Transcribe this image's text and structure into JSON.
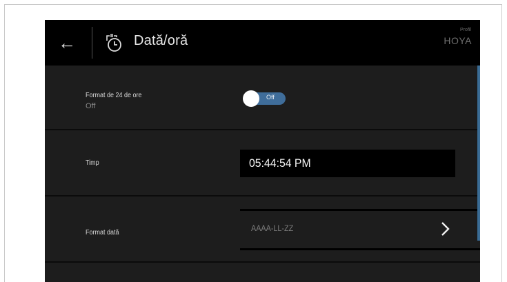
{
  "header": {
    "back_icon": "arrow-left-icon",
    "title_icon": "clock-settings-icon",
    "title": "Dată/oră",
    "profile_label": "Profil",
    "profile_name": "HOYA"
  },
  "settings": {
    "format24": {
      "label": "Format de 24 de ore",
      "status": "Off",
      "toggle_text": "Off",
      "enabled": false
    },
    "time": {
      "label": "Timp",
      "value": "05:44:54 PM"
    },
    "date_format": {
      "label": "Format dată",
      "value": "AAAA-LL-ZZ",
      "action_icon": "chevron-right-icon"
    }
  },
  "colors": {
    "background": "#1d1d1d",
    "header": "#000000",
    "accent": "#3f6d9a"
  }
}
